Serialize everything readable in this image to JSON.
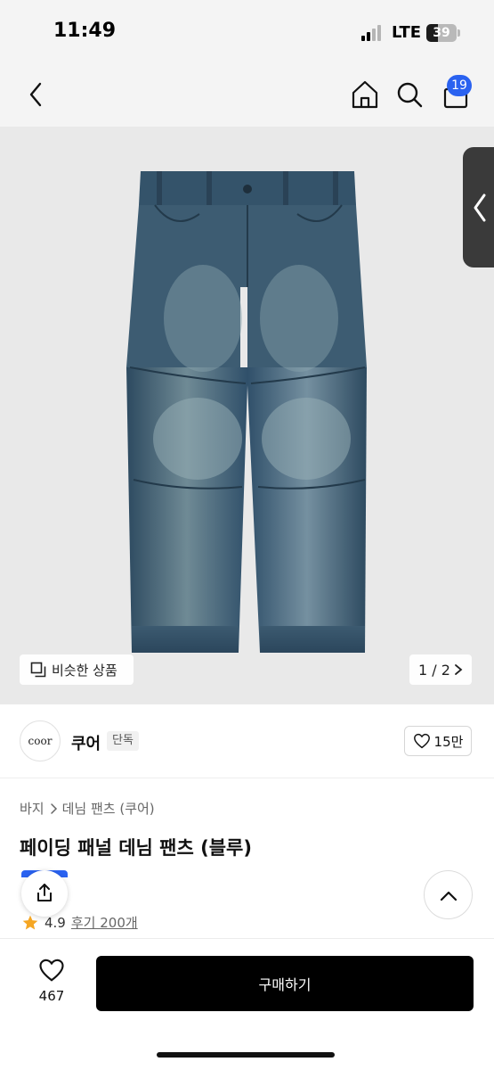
{
  "status_bar": {
    "time": "11:49",
    "network": "LTE",
    "battery_level": "39",
    "battery_fraction": 0.39
  },
  "nav": {
    "cart_count": "19",
    "icons": [
      "back-icon",
      "home-icon",
      "search-icon",
      "cart-icon"
    ]
  },
  "gallery": {
    "similar_label": "비슷한 상품",
    "page_counter": "1 / 2",
    "background_color": "#e9e9e9"
  },
  "brand": {
    "logo_text": "coor",
    "name": "쿠어",
    "tag": "단독",
    "likes": "15만"
  },
  "product": {
    "breadcrumb": [
      "바지",
      "데님 팬츠 (쿠어)"
    ],
    "title": "페이딩 패널 데님 팬츠 (블루)",
    "rating": "4.9",
    "reviews": "후기 200개"
  },
  "bottom_bar": {
    "wish_count": "467",
    "buy_label": "구매하기"
  },
  "colors": {
    "accent_blue": "#2a62f0",
    "star": "#f5a623",
    "buy_button": "#000000"
  }
}
